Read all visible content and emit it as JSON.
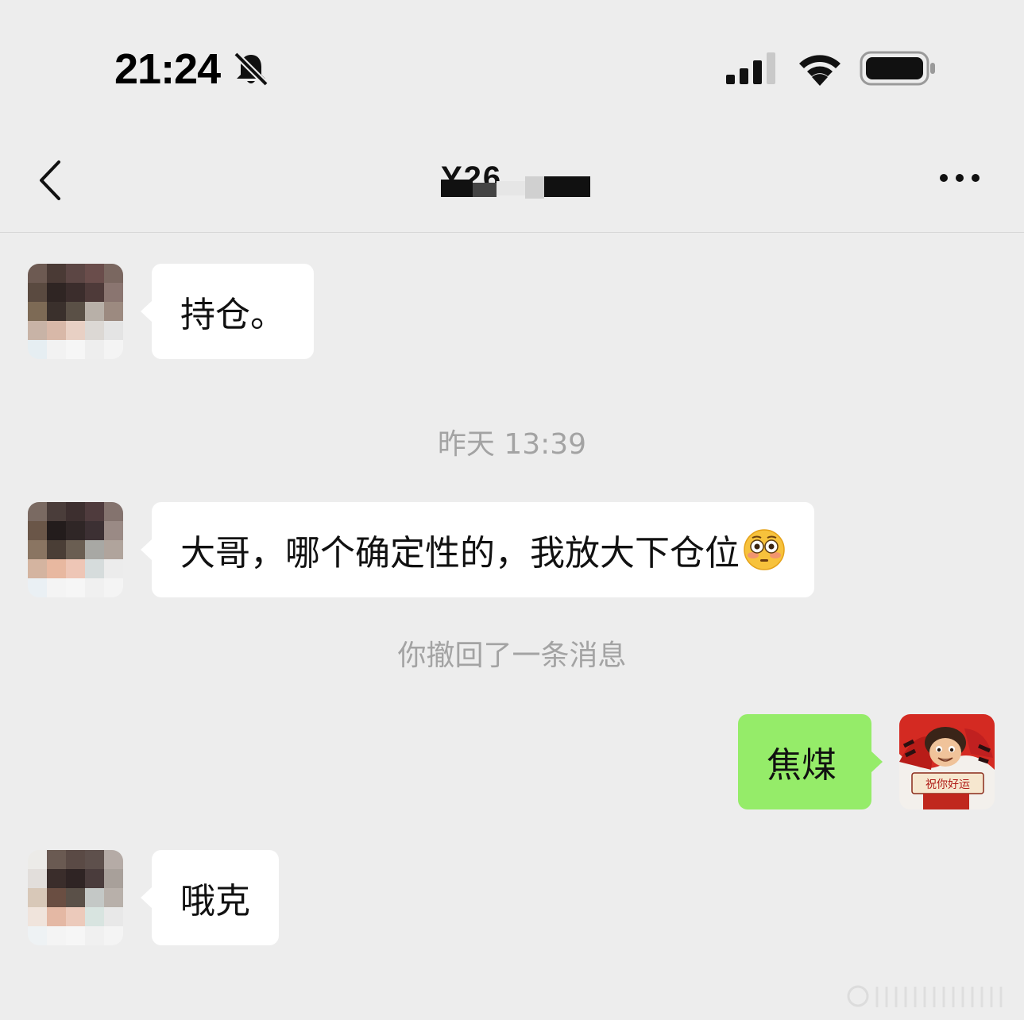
{
  "status_bar": {
    "time": "21:24",
    "mute_icon": "bell-slash-icon",
    "signal_icon": "cellular-signal-icon",
    "wifi_icon": "wifi-icon",
    "battery_icon": "battery-full-icon"
  },
  "nav": {
    "back_icon": "chevron-left-icon",
    "title": "Y26",
    "title_obscured": true,
    "more_icon": "ellipsis-icon"
  },
  "messages": [
    {
      "direction": "incoming",
      "text": "持仓。"
    },
    {
      "type": "timestamp",
      "text": "昨天 13:39"
    },
    {
      "direction": "incoming",
      "text": "大哥，哪个确定性的，我放大下仓位",
      "emoji": "flushed-face-emoji"
    },
    {
      "type": "system",
      "text": "你撤回了一条消息"
    },
    {
      "direction": "outgoing",
      "text": "焦煤"
    },
    {
      "direction": "incoming",
      "text": "哦克"
    }
  ],
  "my_avatar": {
    "caption": "祝你好运"
  },
  "colors": {
    "background": "#ededed",
    "incoming_bubble": "#ffffff",
    "outgoing_bubble": "#95ec69",
    "meta_text": "#a3a3a3"
  }
}
